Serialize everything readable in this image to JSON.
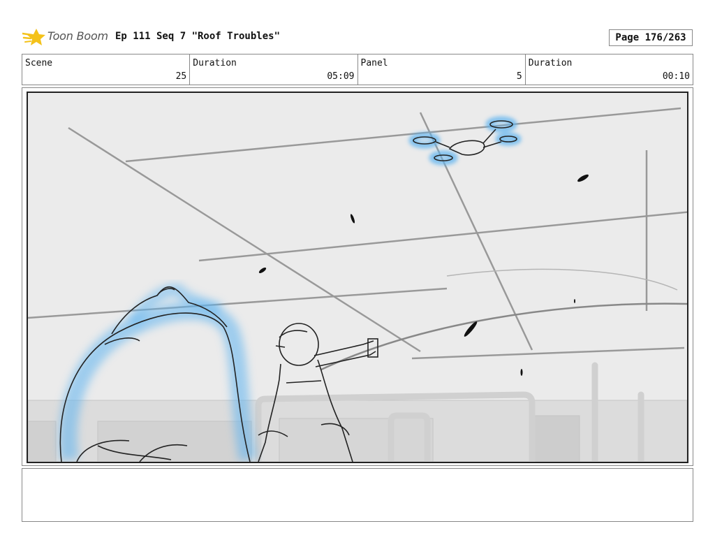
{
  "header": {
    "logo_text": "Toon Boom",
    "episode_title": "Ep 111 Seq 7 \"Roof Troubles\"",
    "page": "Page 176/263"
  },
  "info": {
    "scene_label": "Scene",
    "scene_value": "25",
    "duration_label": "Duration",
    "duration_value": "05:09",
    "panel_label": "Panel",
    "panel_value": "5",
    "panel_duration_label": "Duration",
    "panel_duration_value": "00:10"
  },
  "panel": {
    "icon": "storyboard-sketch",
    "highlight_color": "#5fb4f0"
  },
  "notes": {
    "text": ""
  }
}
